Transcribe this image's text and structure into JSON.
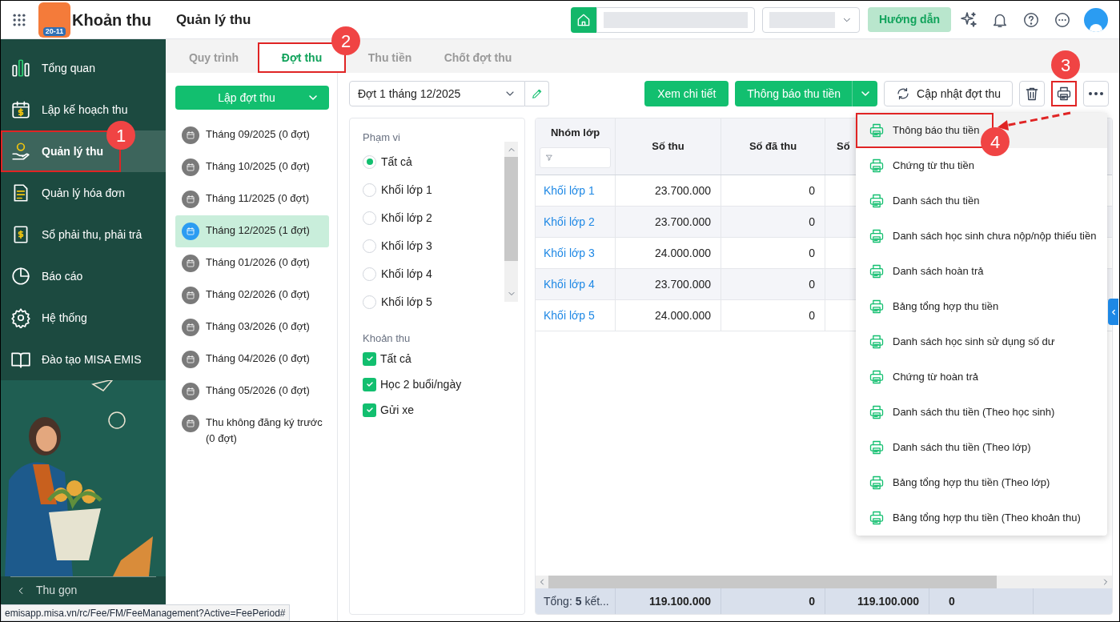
{
  "header": {
    "app_title": "Khoản thu",
    "logo_badge": "20-11",
    "page_title": "Quản lý thu",
    "help_button": "Hướng dẫn"
  },
  "sidebar": {
    "items": [
      {
        "label": "Tổng quan",
        "selected": false
      },
      {
        "label": "Lập kế hoạch thu",
        "selected": false
      },
      {
        "label": "Quản lý thu",
        "selected": true,
        "callout": "1"
      },
      {
        "label": "Quản lý hóa đơn",
        "selected": false
      },
      {
        "label": "Sổ phải thu, phải trả",
        "selected": false
      },
      {
        "label": "Báo cáo",
        "selected": false
      },
      {
        "label": "Hệ thống",
        "selected": false
      },
      {
        "label": "Đào tạo MISA EMIS",
        "selected": false
      }
    ],
    "collapse": "Thu gọn"
  },
  "tabs": [
    {
      "label": "Quy trình",
      "selected": false
    },
    {
      "label": "Đợt thu",
      "selected": true,
      "callout": "2"
    },
    {
      "label": "Thu tiền",
      "selected": false
    },
    {
      "label": "Chốt đợt thu",
      "selected": false
    }
  ],
  "periods": {
    "create_button": "Lập đợt thu",
    "items": [
      {
        "label": "Tháng 09/2025 (0 đợt)",
        "selected": false
      },
      {
        "label": "Tháng 10/2025 (0 đợt)",
        "selected": false
      },
      {
        "label": "Tháng 11/2025 (0 đợt)",
        "selected": false
      },
      {
        "label": "Tháng 12/2025 (1 đợt)",
        "selected": true
      },
      {
        "label": "Tháng 01/2026 (0 đợt)",
        "selected": false
      },
      {
        "label": "Tháng 02/2026 (0 đợt)",
        "selected": false
      },
      {
        "label": "Tháng 03/2026 (0 đợt)",
        "selected": false
      },
      {
        "label": "Tháng 04/2026 (0 đợt)",
        "selected": false
      },
      {
        "label": "Tháng 05/2026 (0 đợt)",
        "selected": false
      },
      {
        "label": "Thu không đăng ký trước (0 đợt)",
        "selected": false
      }
    ]
  },
  "toolbar": {
    "period_select": "Đợt 1 tháng 12/2025",
    "buttons": [
      {
        "kind": "primary",
        "label": "Xem chi tiết"
      },
      {
        "kind": "split",
        "label": "Thông báo thu tiền"
      },
      {
        "kind": "refresh",
        "label": "Cập nhật đợt thu"
      },
      {
        "kind": "delete"
      },
      {
        "kind": "print",
        "callout": "3"
      },
      {
        "kind": "more"
      }
    ]
  },
  "filters": {
    "scope_label": "Phạm vi",
    "scope": [
      {
        "label": "Tất cả",
        "selected": true
      },
      {
        "label": "Khối lớp 1",
        "selected": false
      },
      {
        "label": "Khối lớp 2",
        "selected": false
      },
      {
        "label": "Khối lớp 3",
        "selected": false
      },
      {
        "label": "Khối lớp 4",
        "selected": false
      },
      {
        "label": "Khối lớp 5",
        "selected": false
      }
    ],
    "fees_label": "Khoản thu",
    "fees": [
      {
        "label": "Tất cả",
        "checked": true
      },
      {
        "label": "Học 2 buổi/ngày",
        "checked": true
      },
      {
        "label": "Gửi xe",
        "checked": true
      }
    ]
  },
  "table": {
    "columns": [
      "Nhóm lớp",
      "Số thu",
      "Số đã thu",
      "Số"
    ],
    "rows": [
      {
        "group": "Khối lớp 1",
        "amount": "23.700.000",
        "collected": "0"
      },
      {
        "group": "Khối lớp 2",
        "amount": "23.700.000",
        "collected": "0"
      },
      {
        "group": "Khối lớp 3",
        "amount": "24.000.000",
        "collected": "0"
      },
      {
        "group": "Khối lớp 4",
        "amount": "23.700.000",
        "collected": "0"
      },
      {
        "group": "Khối lớp 5",
        "amount": "24.000.000",
        "collected": "0"
      }
    ],
    "footer": [
      "Tổng: **5** kết...",
      "119.100.000",
      "0",
      "119.100.000",
      "0"
    ]
  },
  "print_menu": [
    {
      "label": "Thông báo thu tiền",
      "selected": true,
      "callout": "4"
    },
    {
      "label": "Chứng từ thu tiền",
      "selected": false
    },
    {
      "label": "Danh sách thu tiền",
      "selected": false
    },
    {
      "label": "Danh sách học sinh chưa nộp/nộp thiếu tiền",
      "selected": false
    },
    {
      "label": "Danh sách hoàn trả",
      "selected": false
    },
    {
      "label": "Bảng tổng hợp thu tiền",
      "selected": false
    },
    {
      "label": "Danh sách học sinh sử dụng số dư",
      "selected": false
    },
    {
      "label": "Chứng từ hoàn trả",
      "selected": false
    },
    {
      "label": "Danh sách thu tiền (Theo học sinh)",
      "selected": false
    },
    {
      "label": "Danh sách thu tiền (Theo lớp)",
      "selected": false
    },
    {
      "label": "Bảng tổng hợp thu tiền (Theo lớp)",
      "selected": false
    },
    {
      "label": "Bảng tổng hợp thu tiền (Theo khoản thu)",
      "selected": false
    }
  ],
  "status_url": "emisapp.misa.vn/rc/Fee/FM/FeeManagement?Active=FeePeriod#"
}
